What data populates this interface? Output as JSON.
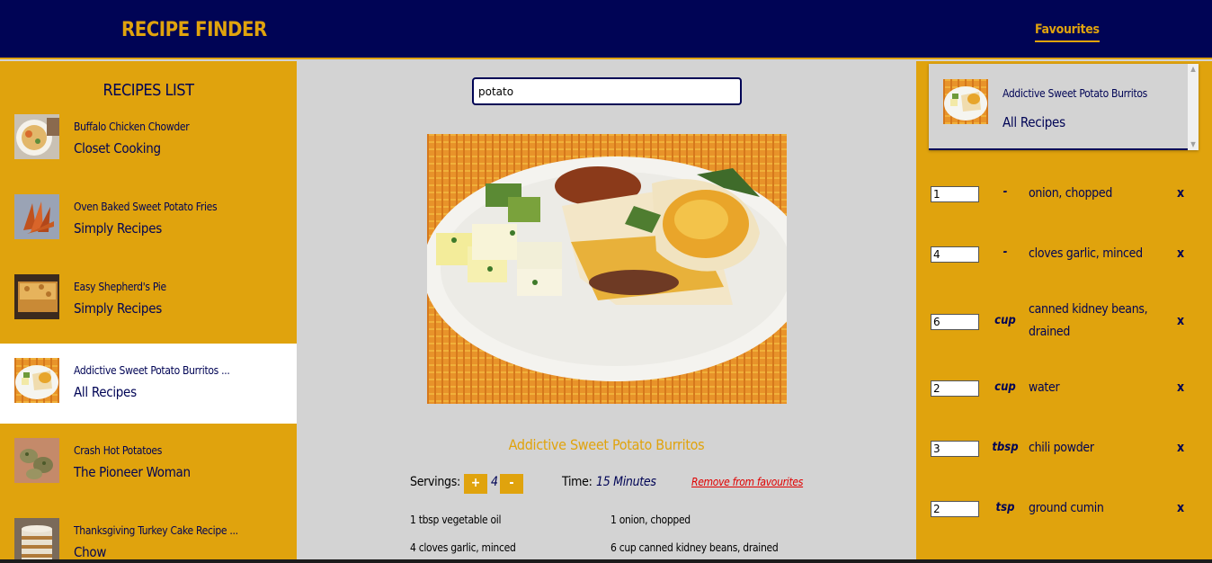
{
  "header": {
    "brand": "RECIPE FINDER",
    "favourites_link": "Favourites"
  },
  "recipes_list": {
    "title": "RECIPES LIST",
    "items": [
      {
        "name": "Buffalo Chicken Chowder",
        "publisher": "Closet Cooking"
      },
      {
        "name": "Oven Baked Sweet Potato Fries",
        "publisher": "Simply Recipes"
      },
      {
        "name": "Easy Shepherd's Pie",
        "publisher": "Simply Recipes"
      },
      {
        "name": "Addictive Sweet Potato Burritos ...",
        "publisher": "All Recipes"
      },
      {
        "name": "Crash Hot Potatoes",
        "publisher": "The Pioneer Woman"
      },
      {
        "name": "Thanksgiving Turkey Cake Recipe ...",
        "publisher": "Chow"
      }
    ],
    "active_index": 3
  },
  "search": {
    "value": "potato"
  },
  "recipe": {
    "title": "Addictive Sweet Potato Burritos",
    "servings_label": "Servings:",
    "plus_label": "+",
    "servings": "4",
    "minus_label": "-",
    "time_label": "Time:",
    "time_value": "15 Minutes",
    "remove_label": "Remove from favourites",
    "ingredients": [
      "1 tbsp vegetable oil",
      "1 onion, chopped",
      "4 cloves garlic, minced",
      "6 cup canned kidney beans, drained"
    ]
  },
  "favourites": {
    "items": [
      {
        "name": "Addictive Sweet Potato Burritos",
        "publisher": "All Recipes"
      }
    ]
  },
  "shopping_list": [
    {
      "qty": "1",
      "unit": "-",
      "name": "onion, chopped",
      "remove": "x"
    },
    {
      "qty": "4",
      "unit": "-",
      "name": "cloves garlic, minced",
      "remove": "x"
    },
    {
      "qty": "6",
      "unit": "cup",
      "name": "canned kidney beans, drained",
      "remove": "x"
    },
    {
      "qty": "2",
      "unit": "cup",
      "name": "water",
      "remove": "x"
    },
    {
      "qty": "3",
      "unit": "tbsp",
      "name": "chili powder",
      "remove": "x"
    },
    {
      "qty": "2",
      "unit": "tsp",
      "name": "ground cumin",
      "remove": "x"
    }
  ],
  "colors": {
    "navy": "#000455",
    "gold": "#e0a30d",
    "grey": "#d3d3d3",
    "remove_red": "#e00000"
  }
}
